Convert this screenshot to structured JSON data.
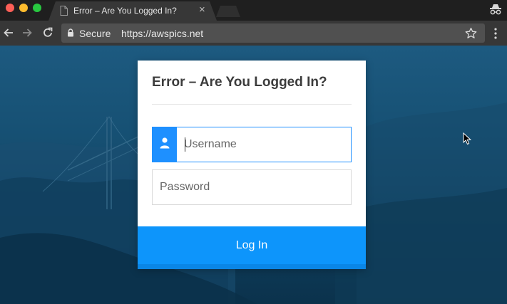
{
  "browser": {
    "tab": {
      "title": "Error – Are You Logged In?",
      "close_glyph": "×"
    },
    "omnibox": {
      "secure_label": "Secure",
      "url": "https://awspics.net"
    },
    "icons": [
      "document-icon",
      "close-icon",
      "incognito-icon",
      "back-icon",
      "forward-icon",
      "reload-icon",
      "lock-icon",
      "star-icon",
      "menu-icon"
    ]
  },
  "login_card": {
    "title": "Error – Are You Logged In?",
    "username_placeholder": "Username",
    "password_placeholder": "Password",
    "login_label": "Log In"
  },
  "colors": {
    "accent": "#1e90ff",
    "button": "#0d95fb",
    "background": "#165073"
  }
}
